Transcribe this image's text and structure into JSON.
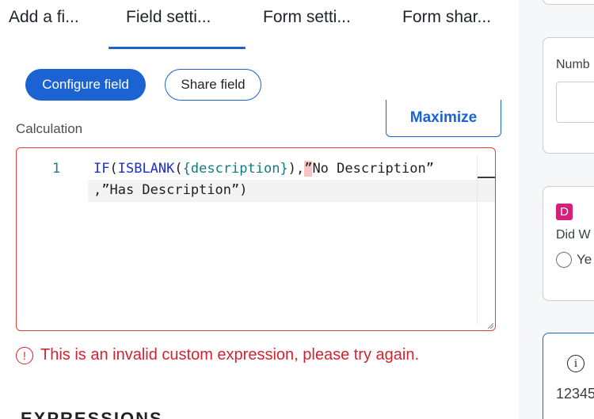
{
  "tabs": [
    {
      "label": "Add a fi...",
      "active": false
    },
    {
      "label": "Field setti...",
      "active": true
    },
    {
      "label": "Form setti...",
      "active": false
    },
    {
      "label": "Form shar...",
      "active": false
    }
  ],
  "buttons": {
    "configure_field": "Configure field",
    "share_field": "Share field",
    "maximize": "Maximize"
  },
  "calculation": {
    "label": "Calculation",
    "line_number": "1",
    "code": {
      "fn_if": "IF",
      "paren_open_1": "(",
      "fn_isblank": "ISBLANK",
      "paren_open_2": "(",
      "field": "{description}",
      "after_field": "),",
      "error_quote": "”",
      "string_1_rest": "No Description”",
      "line2": ",”Has Description”)"
    },
    "error_icon": "exclamation-circle-icon",
    "error_message": "This is an invalid custom expression, please try again.",
    "error_color": "#d1242f"
  },
  "expressions_heading": "EXPRESSIONS",
  "accent_color": "#1b62d2",
  "right_panel": {
    "number_card": {
      "label": "Numb"
    },
    "radio_card": {
      "badge": "D",
      "badge_color": "#d61f7b",
      "label": "Did W",
      "option": "Ye"
    },
    "info_card": {
      "icon": "info-icon",
      "value": "12345"
    }
  }
}
